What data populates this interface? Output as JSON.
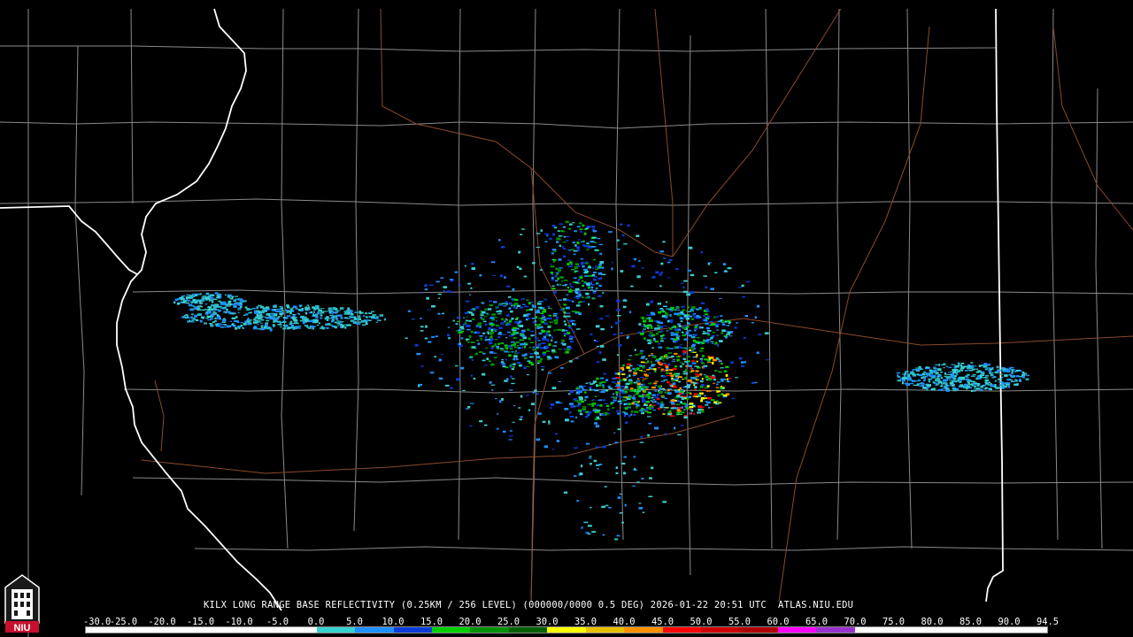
{
  "title": "KILX LONG RANGE BASE REFLECTIVITY (0.25KM / 256 LEVEL) (000000/0000 0.5 DEG) 2026-01-22 20:51 UTC  ATLAS.NIU.EDU",
  "logo": {
    "text": "NIU",
    "icon": "niu-tower-logo-icon",
    "colors": {
      "red": "#c8102e",
      "dark": "#1a1a1a",
      "white": "#ffffff"
    }
  },
  "map": {
    "background": "#000000",
    "county_line_color": "#8a8a8a",
    "state_line_color": "#ffffff",
    "highway_color": "#8a4a2e"
  },
  "scale": {
    "labels": [
      "-30.0",
      "-25.0",
      "-20.0",
      "-15.0",
      "-10.0",
      "-5.0",
      "0.0",
      "5.0",
      "10.0",
      "15.0",
      "20.0",
      "25.0",
      "30.0",
      "35.0",
      "40.0",
      "45.0",
      "50.0",
      "55.0",
      "60.0",
      "65.0",
      "70.0",
      "75.0",
      "80.0",
      "85.0",
      "90.0",
      "94.5"
    ],
    "colors": [
      "#ffffff",
      "#ffffff",
      "#ffffff",
      "#ffffff",
      "#ffffff",
      "#ffffff",
      "#39d0d0",
      "#1e90ff",
      "#0b3bd8",
      "#00d000",
      "#009000",
      "#006000",
      "#ffff00",
      "#e8c000",
      "#ff9000",
      "#ff0000",
      "#d00000",
      "#b00000",
      "#ff00ff",
      "#9933cc",
      "#ffffff",
      "#ffffff",
      "#ffffff",
      "#ffffff",
      "#ffffff"
    ]
  }
}
